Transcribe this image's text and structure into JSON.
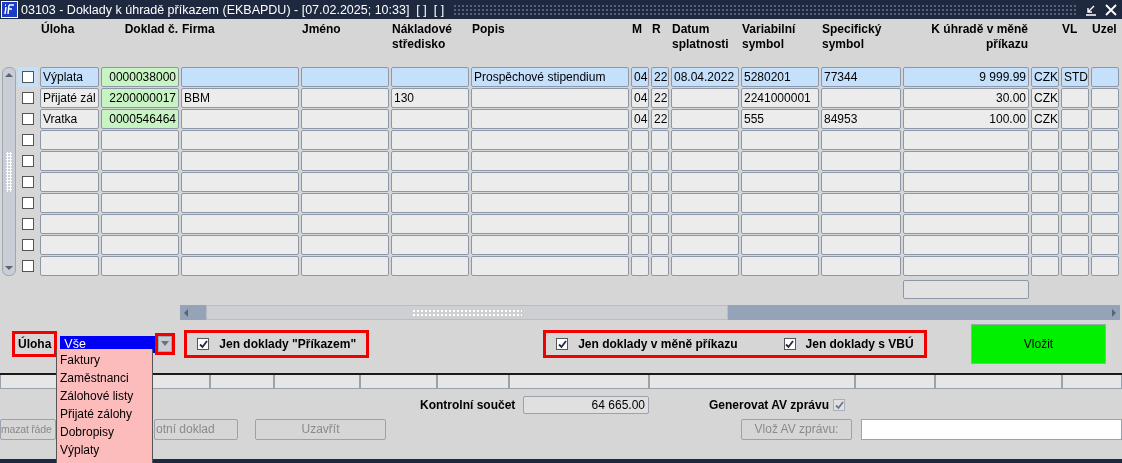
{
  "window": {
    "title": "03103 - Doklady k úhradě příkazem (EKBAPDU) - [07.02.2025; 10:33]  [ ]  [ ]"
  },
  "table": {
    "columns": [
      "Úloha",
      "Doklad č.",
      "Firma",
      "Jméno",
      "Nákladové středisko",
      "Popis",
      "M",
      "R",
      "Datum splatnosti",
      "Variabilní symbol",
      "Specifický symbol",
      "K úhradě v měně příkazu",
      null,
      "VL",
      "Uzel"
    ],
    "rows": [
      {
        "selected": true,
        "checked": false,
        "cells": [
          "Výplata",
          "0000038000",
          null,
          null,
          null,
          "Prospěchové stipendium",
          "04",
          "22",
          "08.04.2022",
          "5280201",
          "77344",
          "9 999.99",
          "CZK",
          "STD",
          null
        ]
      },
      {
        "selected": false,
        "checked": false,
        "cells": [
          "Přijaté zál",
          "2200000017",
          "BBM",
          null,
          "130",
          null,
          "04",
          "22",
          null,
          "2241000001",
          null,
          "30.00",
          "CZK",
          null,
          null
        ]
      },
      {
        "selected": false,
        "checked": false,
        "cells": [
          "Vratka",
          "0000546464",
          null,
          null,
          null,
          null,
          "04",
          "22",
          null,
          "555",
          "84953",
          "100.00",
          "CZK",
          null,
          null
        ]
      },
      {
        "selected": false,
        "checked": false
      },
      {
        "selected": false,
        "checked": false
      },
      {
        "selected": false,
        "checked": false
      },
      {
        "selected": false,
        "checked": false
      },
      {
        "selected": false,
        "checked": false
      },
      {
        "selected": false,
        "checked": false
      },
      {
        "selected": false,
        "checked": false
      }
    ]
  },
  "filter": {
    "label": "Úloha",
    "value": "Vše",
    "expanded": true,
    "options": [
      "Faktury",
      "Zaměstnanci",
      "Zálohové listy",
      "Přijaté zálohy",
      "Dobropisy",
      "Výplaty"
    ]
  },
  "filter_groups": [
    {
      "items": [
        {
          "label": "Jen doklady \"Příkazem\"",
          "checked": true
        }
      ]
    },
    {
      "items": [
        {
          "label": "Jen doklady v měně příkazu",
          "checked": true
        },
        {
          "label": "Jen doklady s VBÚ",
          "checked": true
        }
      ]
    }
  ],
  "insert_button": "Vložit",
  "checksum": {
    "label": "Kontrolní součet",
    "value": "64 665.00"
  },
  "generate_av": {
    "label": "Generovat AV zprávu",
    "checked": true,
    "disabled": true
  },
  "buttons": [
    {
      "label": "mazat řáde",
      "disabled": true
    },
    {
      "label": "otní doklad",
      "disabled": true
    },
    {
      "label": "Uzavřít",
      "disabled": true
    }
  ],
  "av_message": {
    "button": "Vlož AV zprávu:",
    "disabled": true
  }
}
